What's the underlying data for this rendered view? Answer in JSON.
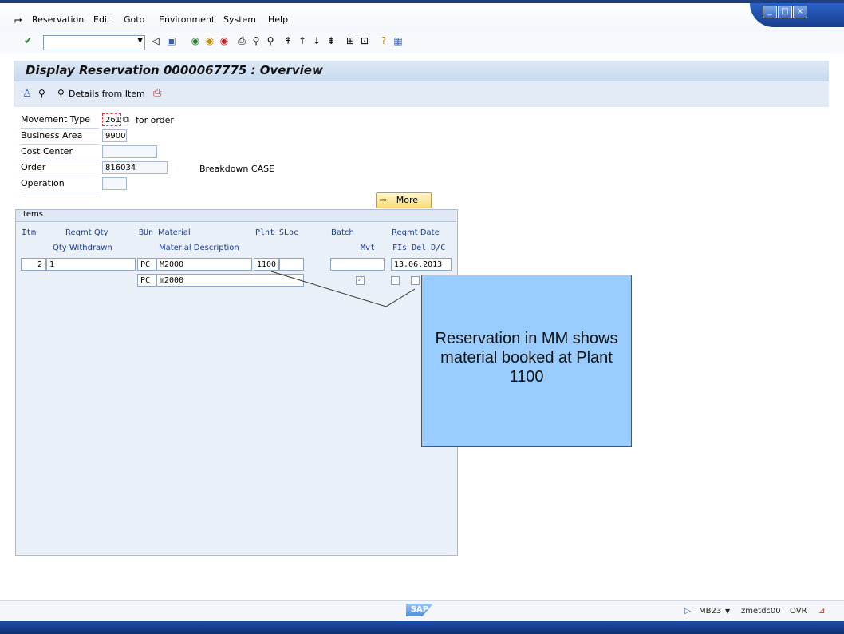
{
  "menu": {
    "items": [
      "Reservation",
      "Edit",
      "Goto",
      "Environment",
      "System",
      "Help"
    ]
  },
  "toolbar": {
    "command_field_value": ""
  },
  "header": {
    "title": "Display Reservation 0000067775 : Overview"
  },
  "app_toolbar": {
    "details_label": "Details from Item"
  },
  "form": {
    "movement_type_label": "Movement Type",
    "movement_type_value": "261",
    "movement_type_text": "for order",
    "business_area_label": "Business Area",
    "business_area_value": "9900",
    "cost_center_label": "Cost Center",
    "cost_center_value": "",
    "order_label": "Order",
    "order_value": "816034",
    "order_text": "Breakdown CASE",
    "operation_label": "Operation",
    "operation_value": "",
    "more_label": "More"
  },
  "items": {
    "section_title": "Items",
    "headers_row1": {
      "itm": "Itm",
      "reqmt_qty": "Reqmt Qty",
      "bun": "BUn",
      "material": "Material",
      "plnt": "Plnt",
      "sloc": "SLoc",
      "batch": "Batch",
      "reqmt_date": "Reqmt Date"
    },
    "headers_row2": {
      "qty_withdrawn": "Qty Withdrawn",
      "material_description": "Material Description",
      "mvt": "Mvt",
      "fis_del_dc": "FIs Del D/C"
    },
    "row": {
      "itm": "2",
      "reqmt_qty": "1",
      "bun": "PC",
      "material": "M2000",
      "plnt": "1100",
      "sloc": "",
      "batch": "",
      "reqmt_date": "13.06.2013",
      "bun2": "PC",
      "material_description": "m2000",
      "mvt_checked": true
    }
  },
  "callout": {
    "text": "Reservation in MM shows material booked at Plant 1100"
  },
  "status": {
    "sap_logo": "SAP",
    "transaction": "MB23",
    "server": "zmetdc00",
    "mode": "OVR"
  }
}
